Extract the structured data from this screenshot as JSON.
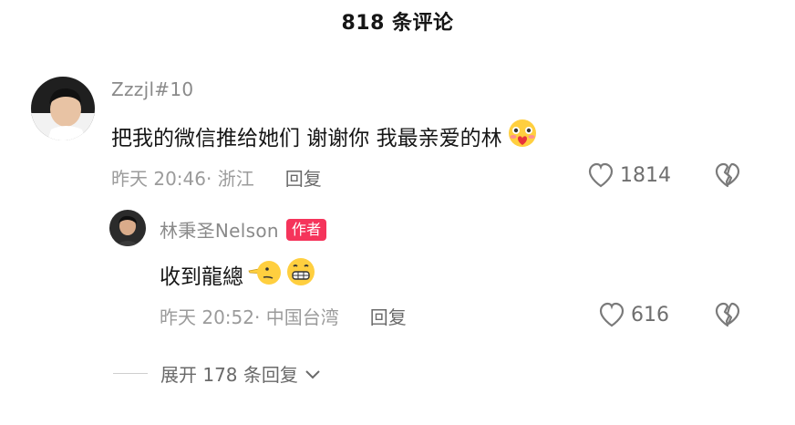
{
  "header": {
    "title": "818 条评论"
  },
  "comment": {
    "username": "Zzzjl#10",
    "text": "把我的微信推给她们 谢谢你 我最亲爱的林",
    "time": "昨天 20:46",
    "location": "· 浙江",
    "reply_label": "回复",
    "likes": "1814",
    "emoji": "blushing-heart-face"
  },
  "reply": {
    "username": "林秉圣Nelson",
    "badge": "作者",
    "text": "收到龍總",
    "time": "昨天 20:52",
    "location": "· 中国台湾",
    "reply_label": "回复",
    "likes": "616",
    "emojis": [
      "pointing-hand-face",
      "grinning-face"
    ]
  },
  "expand": {
    "label": "展开 178 条回复"
  },
  "colors": {
    "badge": "#f5345b",
    "text": "#161616",
    "meta": "#9b9b9b"
  }
}
